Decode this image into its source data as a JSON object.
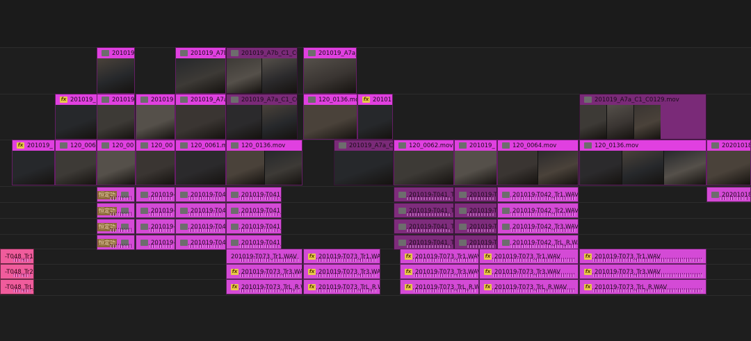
{
  "timeline": {
    "v3": [
      {
        "name": "201019",
        "badge": "gray",
        "tone": "vid"
      },
      {
        "name": "201019_A7b",
        "badge": "gray",
        "tone": "vid"
      },
      {
        "name": "201019_A7b_C1_C0",
        "badge": "gray",
        "tone": "dark"
      },
      {
        "name": "201019_A7a_",
        "badge": "gray",
        "tone": "vid"
      }
    ],
    "v2": [
      {
        "name": "201019_",
        "badge": "fx",
        "tone": "vid"
      },
      {
        "name": "201019",
        "badge": "gray",
        "tone": "vid"
      },
      {
        "name": "201019",
        "badge": "gray",
        "tone": "vid"
      },
      {
        "name": "201019_A7a",
        "badge": "gray",
        "tone": "vid"
      },
      {
        "name": "201019_A7a_C1_C0",
        "badge": "gray",
        "tone": "dark"
      },
      {
        "name": "120_0136.mov",
        "badge": "gray",
        "tone": "vid"
      },
      {
        "name": "20101",
        "badge": "fx",
        "tone": "vid"
      },
      {
        "name": "201019_A7a_C1_C0129.mov",
        "badge": "gray",
        "tone": "dark"
      }
    ],
    "v1": [
      {
        "name": "201019_",
        "badge": "fx",
        "tone": "vid"
      },
      {
        "name": "120_006",
        "badge": "gray",
        "tone": "vid"
      },
      {
        "name": "120_00",
        "badge": "gray",
        "tone": "vid"
      },
      {
        "name": "120_00",
        "badge": "gray",
        "tone": "vid"
      },
      {
        "name": "120_0061.m",
        "badge": "gray",
        "tone": "vid"
      },
      {
        "name": "120_0136.mov",
        "badge": "gray",
        "tone": "vid"
      },
      {
        "name": "201019_A7a_C",
        "badge": "gray",
        "tone": "dark"
      },
      {
        "name": "120_0062.mov",
        "badge": "gray",
        "tone": "vid"
      },
      {
        "name": "201019_",
        "badge": "gray",
        "tone": "vid"
      },
      {
        "name": "120_0064.mov",
        "badge": "gray",
        "tone": "vid"
      },
      {
        "name": "120_0136.mov",
        "badge": "gray",
        "tone": "vid"
      },
      {
        "name": "20201018_",
        "badge": "gray",
        "tone": "vid"
      }
    ],
    "a1": [
      {
        "cn": "恒定功",
        "name": "",
        "tone": "aud"
      },
      {
        "cn": "",
        "name": "201019-",
        "tone": "aud"
      },
      {
        "cn": "",
        "name": "201019-T04",
        "tone": "aud"
      },
      {
        "cn": "",
        "name": "201019-T041_",
        "tone": "aud"
      },
      {
        "cn": "",
        "name": "201019-T041_Tr",
        "tone": "dark"
      },
      {
        "cn": "",
        "name": "201019-T",
        "tone": "dark"
      },
      {
        "cn": "",
        "name": "201019-T042_Tr1.WAV",
        "tone": "aud"
      },
      {
        "cn": "",
        "name": "20201018_",
        "tone": "aud"
      }
    ],
    "a2": [
      {
        "cn": "恒定功",
        "name": "",
        "tone": "aud"
      },
      {
        "cn": "",
        "name": "201019-",
        "tone": "aud"
      },
      {
        "cn": "",
        "name": "201019-T04",
        "tone": "aud"
      },
      {
        "cn": "",
        "name": "201019-T041_",
        "tone": "aud"
      },
      {
        "cn": "",
        "name": "201019-T041_Tr",
        "tone": "dark"
      },
      {
        "cn": "",
        "name": "201019-T",
        "tone": "dark"
      },
      {
        "cn": "",
        "name": "201019-T042_Tr2.WAV",
        "tone": "aud"
      }
    ],
    "a3": [
      {
        "cn": "恒定功",
        "name": "",
        "tone": "aud"
      },
      {
        "cn": "",
        "name": "201019-",
        "tone": "aud"
      },
      {
        "cn": "",
        "name": "201019-T04",
        "tone": "aud"
      },
      {
        "cn": "",
        "name": "201019-T041_",
        "tone": "aud"
      },
      {
        "cn": "",
        "name": "201019-T041_Tr",
        "tone": "dark"
      },
      {
        "cn": "",
        "name": "201019-T",
        "tone": "dark"
      },
      {
        "cn": "",
        "name": "201019-T042_Tr3.WAV",
        "tone": "aud"
      }
    ],
    "a4": [
      {
        "cn": "恒定功",
        "name": "",
        "tone": "aud"
      },
      {
        "cn": "",
        "name": "201019-",
        "tone": "aud"
      },
      {
        "cn": "",
        "name": "201019-T04",
        "tone": "aud"
      },
      {
        "cn": "",
        "name": "201019-T041_",
        "tone": "aud"
      },
      {
        "cn": "",
        "name": "201019-T041_Tr",
        "tone": "dark"
      },
      {
        "cn": "",
        "name": "201019-T",
        "tone": "dark"
      },
      {
        "cn": "",
        "name": "201019-T042_TrL_R.WA",
        "tone": "aud"
      }
    ],
    "a5": [
      {
        "name": "-T048_Tr1.W",
        "badge": "",
        "tone": "pink"
      },
      {
        "name": "201019-T073_Tr1.WAV",
        "badge": "",
        "tone": "aud"
      },
      {
        "name": "201019-T073_Tr1.WAV",
        "badge": "fx",
        "tone": "aud"
      },
      {
        "name": "201019-T073_Tr1.WAV",
        "badge": "fx",
        "tone": "aud"
      },
      {
        "name": "201019-T073_Tr1.WAV",
        "badge": "fx",
        "tone": "aud"
      },
      {
        "name": "201019-T073_Tr1.WAV",
        "badge": "fx",
        "tone": "aud"
      }
    ],
    "a6": [
      {
        "name": "-T048_Tr2.W",
        "badge": "",
        "tone": "pink"
      },
      {
        "name": "201019-T073_Tr3.WAV",
        "badge": "fx",
        "tone": "aud"
      },
      {
        "name": "201019-T073_Tr3.WAV",
        "badge": "fx",
        "tone": "aud"
      },
      {
        "name": "201019-T073_Tr3.WAV",
        "badge": "fx",
        "tone": "aud"
      },
      {
        "name": "201019-T073_Tr3.WAV",
        "badge": "fx",
        "tone": "aud"
      },
      {
        "name": "201019-T073_Tr3.WAV",
        "badge": "fx",
        "tone": "aud"
      }
    ],
    "a7": [
      {
        "name": "-T048_TrL_R",
        "badge": "",
        "tone": "pink"
      },
      {
        "name": "201019-T073_TrL_R.W",
        "badge": "fx",
        "tone": "aud"
      },
      {
        "name": "201019-T073_TrL_R.WAV",
        "badge": "fx",
        "tone": "aud"
      },
      {
        "name": "201019-T073_TrL_R.WA",
        "badge": "fx",
        "tone": "aud"
      },
      {
        "name": "201019-T073_TrL_R.WAV",
        "badge": "fx",
        "tone": "aud"
      },
      {
        "name": "201019-T073_TrL_R.WAV",
        "badge": "fx",
        "tone": "aud"
      }
    ]
  },
  "colors": {
    "video": "#e040e0",
    "video_dim": "#7a2a78",
    "audio": "#d44ad6",
    "audio_dim": "#7e2c7c",
    "audio_pink": "#f05c9c",
    "fx_badge": "#e8c94a"
  }
}
